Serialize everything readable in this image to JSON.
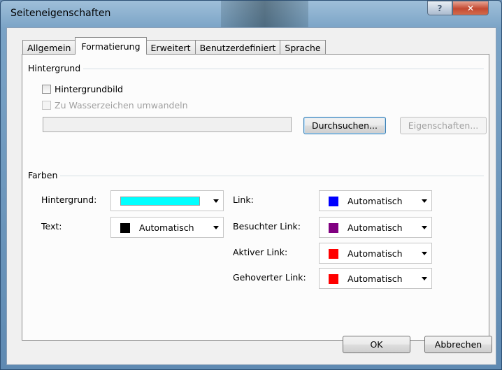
{
  "window": {
    "title": "Seiteneigenschaften",
    "help_glyph": "?",
    "close_glyph": "✕"
  },
  "tabs": [
    {
      "label": "Allgemein",
      "active": false
    },
    {
      "label": "Formatierung",
      "active": true
    },
    {
      "label": "Erweitert",
      "active": false
    },
    {
      "label": "Benutzerdefiniert",
      "active": false
    },
    {
      "label": "Sprache",
      "active": false
    }
  ],
  "background_group": {
    "label": "Hintergrund",
    "bg_image_checkbox": {
      "label": "Hintergrundbild",
      "checked": false
    },
    "watermark_checkbox": {
      "label": "Zu Wasserzeichen umwandeln",
      "checked": false,
      "disabled": true
    },
    "path_input": {
      "value": ""
    },
    "browse_button": "Durchsuchen...",
    "properties_button": "Eigenschaften..."
  },
  "colors_group": {
    "label": "Farben",
    "background": {
      "label": "Hintergrund:",
      "value": "",
      "color": "#00ffff"
    },
    "text": {
      "label": "Text:",
      "value": "Automatisch",
      "color": "#000000"
    },
    "link": {
      "label": "Link:",
      "value": "Automatisch",
      "color": "#0000ff"
    },
    "visited_link": {
      "label": "Besuchter Link:",
      "value": "Automatisch",
      "color": "#800080"
    },
    "active_link": {
      "label": "Aktiver Link:",
      "value": "Automatisch",
      "color": "#ff0000"
    },
    "hover_link": {
      "label": "Gehoverter Link:",
      "value": "Automatisch",
      "color": "#ff0000"
    }
  },
  "footer": {
    "ok_label": "OK",
    "cancel_label": "Abbrechen"
  }
}
